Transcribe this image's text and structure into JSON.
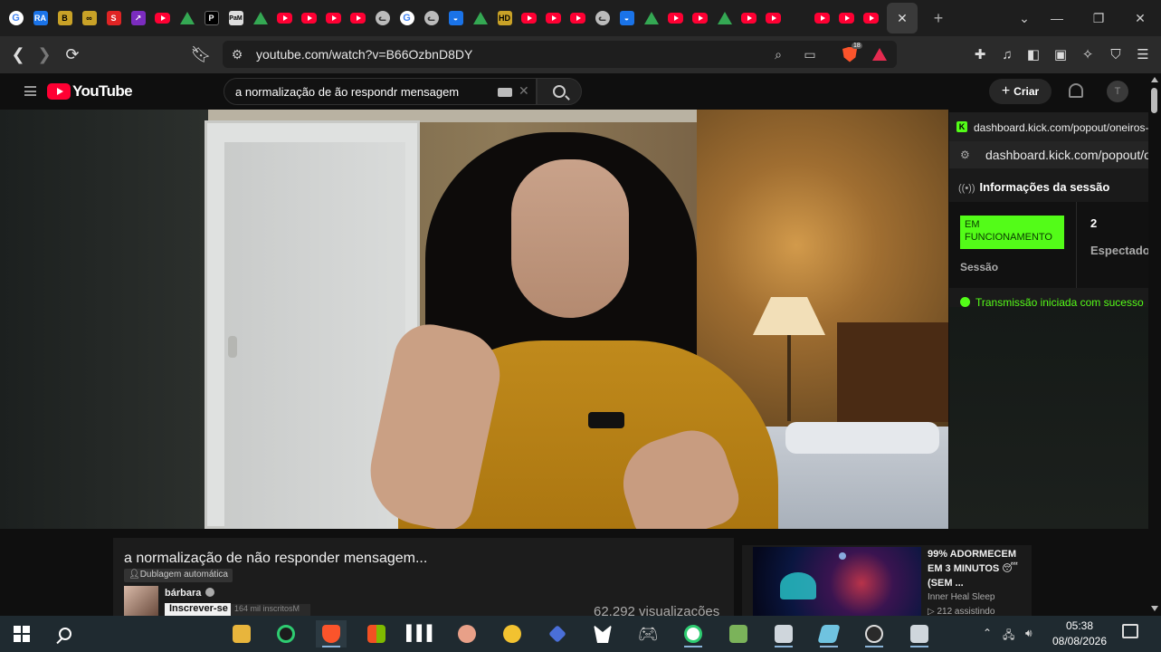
{
  "browser": {
    "tabs": [
      "google",
      "ra",
      "b",
      "link",
      "s",
      "purple",
      "youtube",
      "drive",
      "dark",
      "pam",
      "drive",
      "youtube",
      "youtube",
      "youtube",
      "youtube",
      "cat",
      "google",
      "cat",
      "blue",
      "drive",
      "hd",
      "youtube",
      "youtube",
      "youtube",
      "cat",
      "blue",
      "drive",
      "youtube",
      "youtube",
      "drive",
      "youtube",
      "youtube",
      "kick",
      "youtube",
      "youtube",
      "youtube"
    ],
    "active_tab_close": "✕",
    "new_tab": "+",
    "url": "youtube.com/watch?v=B66OzbnD8DY",
    "brave_badge": "18"
  },
  "youtube": {
    "logo_text": "YouTube",
    "search_query": "a normalização de ão respondr mensagem",
    "create_label": "Criar",
    "avatar_letter": "T"
  },
  "kick_popout": {
    "window_title": "dashboard.kick.com/popout/oneiros-fc",
    "url": "dashboard.kick.com/popout/on",
    "section_title": "Informações da sessão",
    "status_badge": "EM FUNCIONAMENTO",
    "session_label": "Sessão",
    "viewers_count": "2",
    "viewers_label": "Espectadores",
    "status_message": "Transmissão iniciada com sucesso"
  },
  "video_info": {
    "title": "a normalização de não responder mensagem...",
    "dubbing_label": "Dublagem automática",
    "channel_name": "bárbara",
    "subscribe_label": "Inscrever-se",
    "subscriber_count": "164 mil inscritosM",
    "views": "62.292 visualizações"
  },
  "related_video": {
    "title": "99% ADORMECEM EM 3 MINUTOS 😴 (SEM ...",
    "channel": "Inner Heal Sleep",
    "watching": "▷ 212 assistindo"
  },
  "taskbar": {
    "time": "05:38",
    "date": "08/08/2026"
  },
  "colors": {
    "kick_green": "#53fc18",
    "youtube_red": "#ff0033"
  }
}
